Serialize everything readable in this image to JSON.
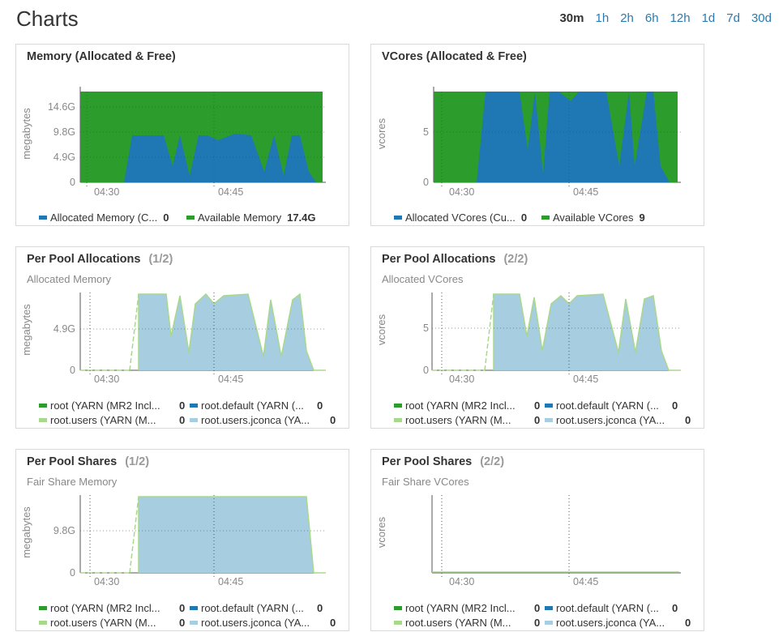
{
  "page": {
    "title": "Charts",
    "ranges": [
      "30m",
      "1h",
      "2h",
      "6h",
      "12h",
      "1d",
      "7d",
      "30d"
    ],
    "active_range": "30m"
  },
  "colors": {
    "green": "#2c9c2c",
    "blue": "#1f77b4",
    "light_green": "#a8d88c",
    "light_blue": "#a6cde0"
  },
  "cards": [
    {
      "title": "Memory (Allocated & Free)",
      "page": "",
      "subtitle": "",
      "ylabel": "megabytes",
      "yticks": [
        "14.6G",
        "9.8G",
        "4.9G",
        "0"
      ],
      "xticks": [
        "04:30",
        "04:45"
      ],
      "legend": [
        {
          "name": "Allocated Memory (C...",
          "value": "0",
          "color": "#1f77b4"
        },
        {
          "name": "Available Memory",
          "value": "17.4G",
          "color": "#2c9c2c"
        }
      ]
    },
    {
      "title": "VCores (Allocated & Free)",
      "page": "",
      "subtitle": "",
      "ylabel": "vcores",
      "yticks": [
        "5",
        "0"
      ],
      "xticks": [
        "04:30",
        "04:45"
      ],
      "legend": [
        {
          "name": "Allocated VCores (Cu...",
          "value": "0",
          "color": "#1f77b4"
        },
        {
          "name": "Available VCores",
          "value": "9",
          "color": "#2c9c2c"
        }
      ]
    },
    {
      "title": "Per Pool Allocations",
      "page": "(1/2)",
      "subtitle": "Allocated Memory",
      "ylabel": "megabytes",
      "yticks": [
        "4.9G",
        "0"
      ],
      "xticks": [
        "04:30",
        "04:45"
      ],
      "legend": [
        {
          "name": "root (YARN (MR2 Incl...",
          "value": "0",
          "color": "#2c9c2c"
        },
        {
          "name": "root.default (YARN (...",
          "value": "0",
          "color": "#1f77b4"
        },
        {
          "name": "root.users (YARN (M...",
          "value": "0",
          "color": "#a8d88c"
        },
        {
          "name": "root.users.jconca (YA...",
          "value": "0",
          "color": "#a6cde0"
        }
      ]
    },
    {
      "title": "Per Pool Allocations",
      "page": "(2/2)",
      "subtitle": "Allocated VCores",
      "ylabel": "vcores",
      "yticks": [
        "5",
        "0"
      ],
      "xticks": [
        "04:30",
        "04:45"
      ],
      "legend": [
        {
          "name": "root (YARN (MR2 Incl...",
          "value": "0",
          "color": "#2c9c2c"
        },
        {
          "name": "root.default (YARN (...",
          "value": "0",
          "color": "#1f77b4"
        },
        {
          "name": "root.users (YARN (M...",
          "value": "0",
          "color": "#a8d88c"
        },
        {
          "name": "root.users.jconca (YA...",
          "value": "0",
          "color": "#a6cde0"
        }
      ]
    },
    {
      "title": "Per Pool Shares",
      "page": "(1/2)",
      "subtitle": "Fair Share Memory",
      "ylabel": "megabytes",
      "yticks": [
        "9.8G",
        "0"
      ],
      "xticks": [
        "04:30",
        "04:45"
      ],
      "legend": [
        {
          "name": "root (YARN (MR2 Incl...",
          "value": "0",
          "color": "#2c9c2c"
        },
        {
          "name": "root.default (YARN (...",
          "value": "0",
          "color": "#1f77b4"
        },
        {
          "name": "root.users (YARN (M...",
          "value": "0",
          "color": "#a8d88c"
        },
        {
          "name": "root.users.jconca (YA...",
          "value": "0",
          "color": "#a6cde0"
        }
      ]
    },
    {
      "title": "Per Pool Shares",
      "page": "(2/2)",
      "subtitle": "Fair Share VCores",
      "ylabel": "vcores",
      "yticks": [],
      "xticks": [
        "04:30",
        "04:45"
      ],
      "legend": [
        {
          "name": "root (YARN (MR2 Incl...",
          "value": "0",
          "color": "#2c9c2c"
        },
        {
          "name": "root.default (YARN (...",
          "value": "0",
          "color": "#1f77b4"
        },
        {
          "name": "root.users (YARN (M...",
          "value": "0",
          "color": "#a8d88c"
        },
        {
          "name": "root.users.jconca (YA...",
          "value": "0",
          "color": "#a6cde0"
        }
      ]
    }
  ]
}
